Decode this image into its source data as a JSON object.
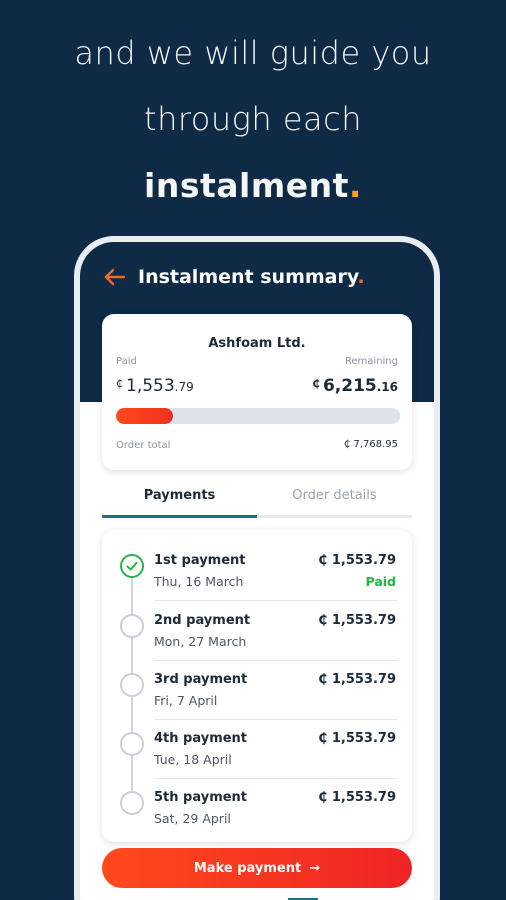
{
  "promo": {
    "line1": "and we will guide you",
    "line2": "through each",
    "line3": "instalment",
    "dot": "."
  },
  "header": {
    "title": "Instalment summary",
    "dot": "."
  },
  "summary": {
    "merchant": "Ashfoam Ltd.",
    "paid_label": "Paid",
    "remaining_label": "Remaining",
    "currency": "₵",
    "paid_int": "1,553",
    "paid_dec": ".79",
    "remaining_int": "6,215",
    "remaining_dec": ".16",
    "progress_fraction": 0.2,
    "order_total_label": "Order total",
    "order_total": "₵ 7,768.95"
  },
  "tabs": [
    {
      "label": "Payments",
      "active": true
    },
    {
      "label": "Order details",
      "active": false
    }
  ],
  "payments": [
    {
      "name": "1st payment",
      "date": "Thu, 16 March",
      "amount": "₵ 1,553.79",
      "status": "Paid"
    },
    {
      "name": "2nd payment",
      "date": "Mon, 27 March",
      "amount": "₵ 1,553.79",
      "status": ""
    },
    {
      "name": "3rd payment",
      "date": "Fri, 7 April",
      "amount": "₵ 1,553.79",
      "status": ""
    },
    {
      "name": "4th payment",
      "date": "Tue, 18 April",
      "amount": "₵ 1,553.79",
      "status": ""
    },
    {
      "name": "5th payment",
      "date": "Sat, 29 April",
      "amount": "₵ 1,553.79",
      "status": ""
    }
  ],
  "action": {
    "make_payment": "Make payment",
    "arrow": "→"
  },
  "colors": {
    "background": "#0e2a44",
    "accent": "#f36a22",
    "paid_green": "#2bb24c",
    "tab_underline": "#1f6f8b"
  },
  "icons": {
    "back": "arrow-left-icon",
    "check": "check-circle-icon",
    "arrow": "arrow-right-icon"
  }
}
